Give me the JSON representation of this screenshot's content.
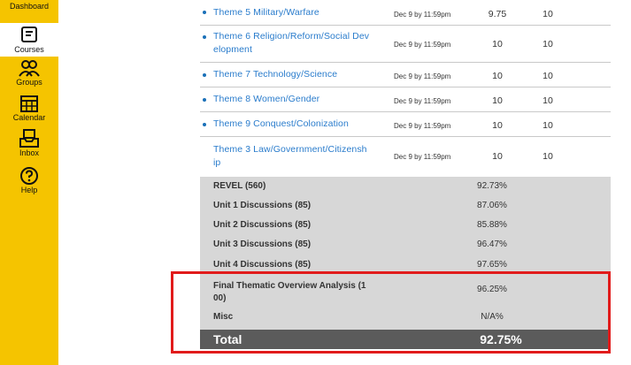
{
  "sidebar": {
    "items": [
      {
        "label": "Dashboard",
        "icon": "dashboard-icon"
      },
      {
        "label": "Courses",
        "icon": "courses-icon"
      },
      {
        "label": "Groups",
        "icon": "groups-icon"
      },
      {
        "label": "Calendar",
        "icon": "calendar-icon"
      },
      {
        "label": "Inbox",
        "icon": "inbox-icon"
      },
      {
        "label": "Help",
        "icon": "help-icon"
      }
    ],
    "active": "Courses",
    "color": "#f5c400"
  },
  "assignments": [
    {
      "name_line1": "Theme 5 Military/Warfare",
      "name_line2": "",
      "due": "Dec 9 by 11:59pm",
      "score": "9.75",
      "possible": "10"
    },
    {
      "name_line1": "Theme 6 Religion/Reform/Social Dev",
      "name_line2": "elopment",
      "due": "Dec 9 by 11:59pm",
      "score": "10",
      "possible": "10"
    },
    {
      "name_line1": "Theme 7 Technology/Science",
      "name_line2": "",
      "due": "Dec 9 by 11:59pm",
      "score": "10",
      "possible": "10"
    },
    {
      "name_line1": "Theme 8 Women/Gender",
      "name_line2": "",
      "due": "Dec 9 by 11:59pm",
      "score": "10",
      "possible": "10"
    },
    {
      "name_line1": "Theme 9 Conquest/Colonization",
      "name_line2": "",
      "due": "Dec 9 by 11:59pm",
      "score": "10",
      "possible": "10"
    },
    {
      "name_line1": "Theme 3 Law/Government/Citizensh",
      "name_line2": "ip",
      "due": "Dec 9 by 11:59pm",
      "score": "10",
      "possible": "10"
    }
  ],
  "groups": [
    {
      "name_line1": "REVEL (560)",
      "name_line2": "",
      "percent": "92.73%"
    },
    {
      "name_line1": "Unit 1 Discussions (85)",
      "name_line2": "",
      "percent": "87.06%"
    },
    {
      "name_line1": "Unit 2 Discussions (85)",
      "name_line2": "",
      "percent": "85.88%"
    },
    {
      "name_line1": "Unit 3 Discussions (85)",
      "name_line2": "",
      "percent": "96.47%"
    },
    {
      "name_line1": "Unit 4 Discussions (85)",
      "name_line2": "",
      "percent": "97.65%"
    },
    {
      "name_line1": "Final Thematic Overview Analysis (1",
      "name_line2": "00)",
      "percent": "96.25%"
    },
    {
      "name_line1": "Misc",
      "name_line2": "",
      "percent": "N/A%"
    }
  ],
  "total": {
    "label": "Total",
    "percent": "92.75%"
  },
  "colors": {
    "link": "#2a7ccc",
    "highlight": "#e11b1b",
    "total_bg": "#5b5b5b",
    "summary_bg": "#d7d7d7"
  }
}
